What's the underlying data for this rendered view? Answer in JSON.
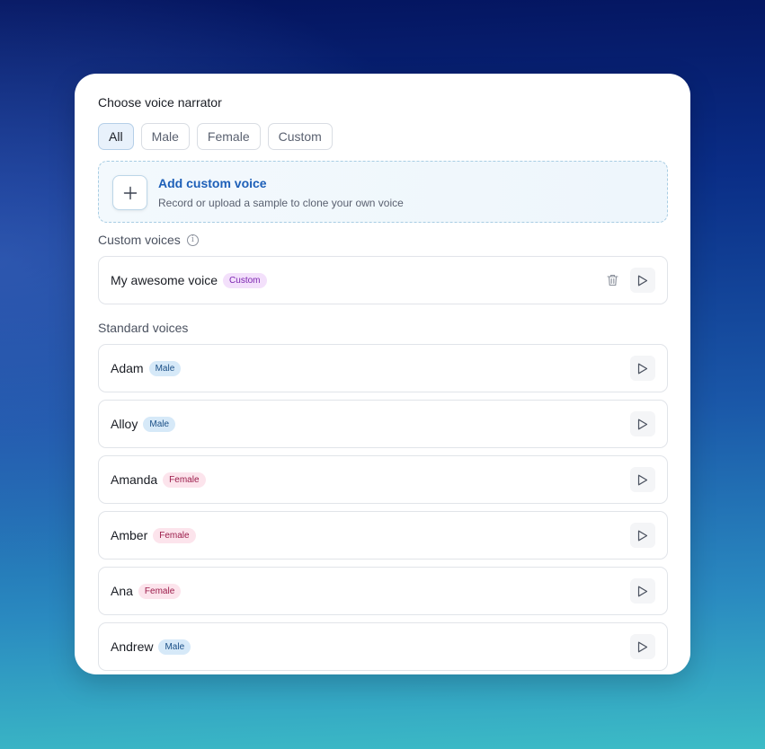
{
  "title": "Choose voice narrator",
  "filters": [
    "All",
    "Male",
    "Female",
    "Custom"
  ],
  "add_custom": {
    "title": "Add custom voice",
    "subtitle": "Record or upload a sample to clone your own voice"
  },
  "custom_section": {
    "label": "Custom voices",
    "info_glyph": "i",
    "voices": [
      {
        "name": "My awesome voice",
        "tag": "Custom"
      }
    ]
  },
  "standard_section": {
    "label": "Standard voices",
    "voices": [
      {
        "name": "Adam",
        "tag": "Male"
      },
      {
        "name": "Alloy",
        "tag": "Male"
      },
      {
        "name": "Amanda",
        "tag": "Female"
      },
      {
        "name": "Amber",
        "tag": "Female"
      },
      {
        "name": "Ana",
        "tag": "Female"
      },
      {
        "name": "Andrew",
        "tag": "Male"
      }
    ]
  },
  "colors": {
    "accent": "#1d5fb8",
    "male_badge": "#d6e9f8",
    "female_badge": "#fce4ec",
    "custom_badge": "#f3e0fb"
  },
  "icons": {
    "add": "plus-icon",
    "info": "info-icon",
    "play": "play-icon",
    "delete": "trash-icon"
  }
}
